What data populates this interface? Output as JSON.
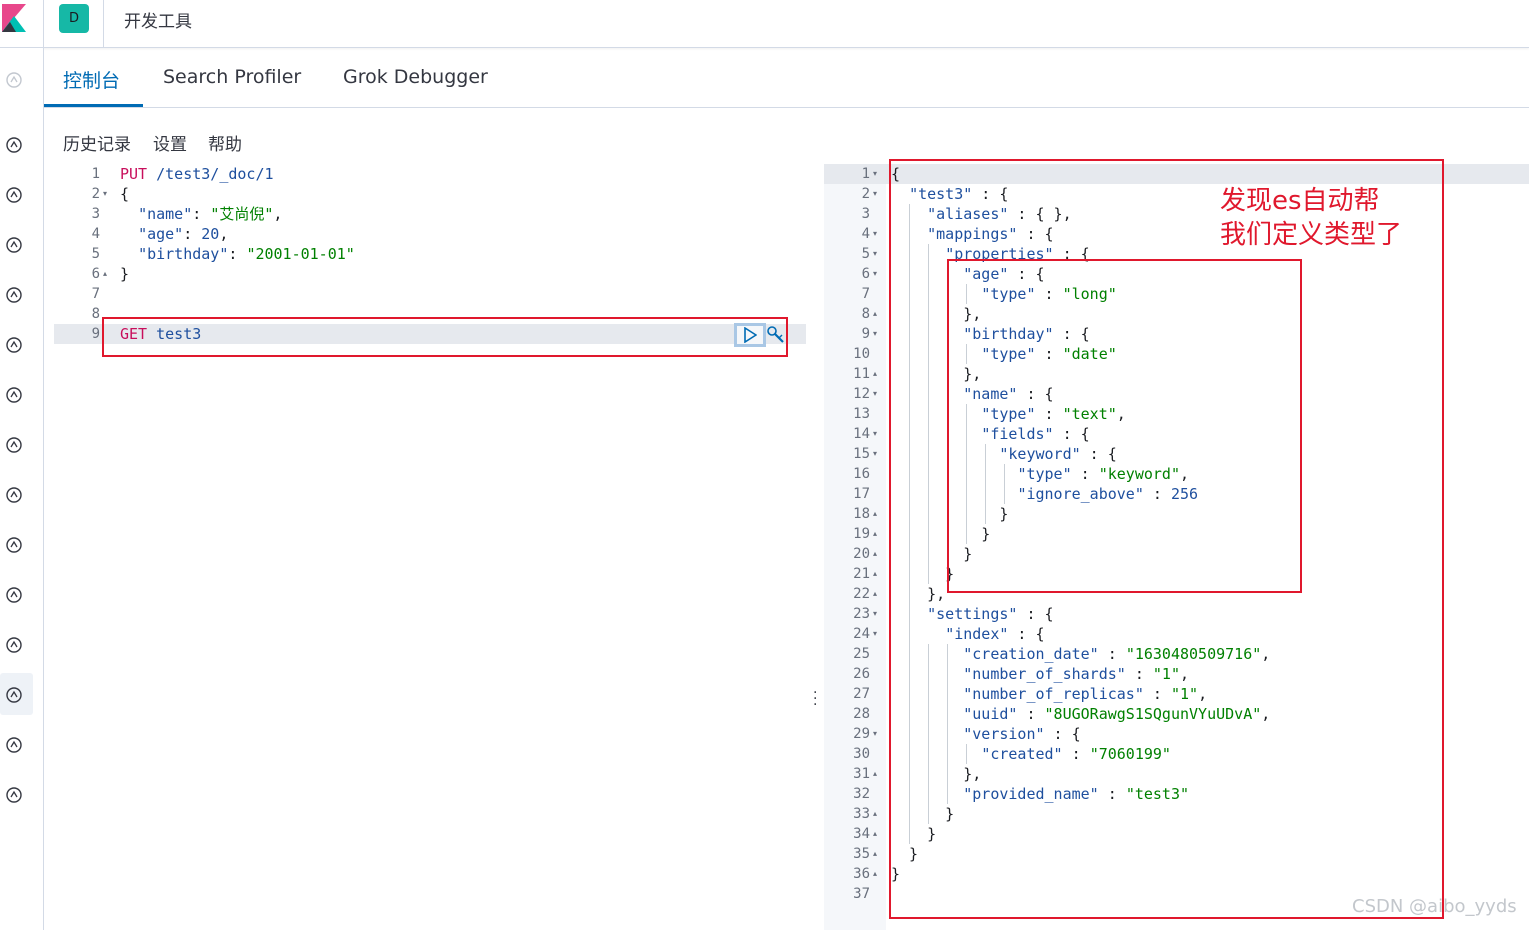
{
  "header": {
    "space_letter": "D",
    "app_title": "开发工具"
  },
  "tabs": [
    {
      "label": "控制台"
    },
    {
      "label": "Search Profiler"
    },
    {
      "label": "Grok Debugger"
    }
  ],
  "toolbar": {
    "history": "历史记录",
    "settings": "设置",
    "help": "帮助"
  },
  "sidenav": {
    "icons": [
      "recently-viewed-icon",
      "discover-icon",
      "visualize-icon",
      "dashboard-icon",
      "canvas-icon",
      "maps-icon",
      "ml-icon",
      "graph-icon",
      "siem-icon",
      "uptime-icon",
      "apm-icon",
      "infrastructure-icon",
      "dev-tools-icon",
      "monitoring-icon",
      "management-icon"
    ]
  },
  "request_editor": {
    "lines": [
      {
        "n": "1",
        "fold": "",
        "segs": [
          [
            "m",
            "PUT"
          ],
          [
            "p",
            " "
          ],
          [
            "u",
            "/test3/_doc/1"
          ]
        ]
      },
      {
        "n": "2",
        "fold": "▾",
        "segs": [
          [
            "p",
            "{"
          ]
        ]
      },
      {
        "n": "3",
        "fold": "",
        "segs": [
          [
            "p",
            "  "
          ],
          [
            "k",
            "\"name\""
          ],
          [
            "p",
            ": "
          ],
          [
            "s",
            "\"艾尚倪\""
          ],
          [
            "p",
            ","
          ]
        ]
      },
      {
        "n": "4",
        "fold": "",
        "segs": [
          [
            "p",
            "  "
          ],
          [
            "k",
            "\"age\""
          ],
          [
            "p",
            ": "
          ],
          [
            "n",
            "20"
          ],
          [
            "p",
            ","
          ]
        ]
      },
      {
        "n": "5",
        "fold": "",
        "segs": [
          [
            "p",
            "  "
          ],
          [
            "k",
            "\"birthday\""
          ],
          [
            "p",
            ": "
          ],
          [
            "s",
            "\"2001-01-01\""
          ]
        ]
      },
      {
        "n": "6",
        "fold": "▴",
        "segs": [
          [
            "p",
            "}"
          ]
        ]
      },
      {
        "n": "7",
        "fold": "",
        "segs": []
      },
      {
        "n": "8",
        "fold": "",
        "segs": []
      },
      {
        "n": "9",
        "fold": "",
        "segs": [
          [
            "m",
            "GET"
          ],
          [
            "p",
            " "
          ],
          [
            "u",
            "test3"
          ]
        ]
      }
    ]
  },
  "response_viewer": {
    "lines": [
      {
        "n": "1",
        "fold": "▾",
        "segs": [
          [
            "p",
            "{"
          ]
        ]
      },
      {
        "n": "2",
        "fold": "▾",
        "segs": [
          [
            "p",
            "  "
          ],
          [
            "k",
            "\"test3\""
          ],
          [
            "p",
            " : {"
          ]
        ]
      },
      {
        "n": "3",
        "fold": "",
        "segs": [
          [
            "p",
            "    "
          ],
          [
            "k",
            "\"aliases\""
          ],
          [
            "p",
            " : { },"
          ]
        ]
      },
      {
        "n": "4",
        "fold": "▾",
        "segs": [
          [
            "p",
            "    "
          ],
          [
            "k",
            "\"mappings\""
          ],
          [
            "p",
            " : {"
          ]
        ]
      },
      {
        "n": "5",
        "fold": "▾",
        "segs": [
          [
            "p",
            "      "
          ],
          [
            "k",
            "\"properties\""
          ],
          [
            "p",
            " : {"
          ]
        ]
      },
      {
        "n": "6",
        "fold": "▾",
        "segs": [
          [
            "p",
            "        "
          ],
          [
            "k",
            "\"age\""
          ],
          [
            "p",
            " : {"
          ]
        ]
      },
      {
        "n": "7",
        "fold": "",
        "segs": [
          [
            "p",
            "          "
          ],
          [
            "k",
            "\"type\""
          ],
          [
            "p",
            " : "
          ],
          [
            "s",
            "\"long\""
          ]
        ]
      },
      {
        "n": "8",
        "fold": "▴",
        "segs": [
          [
            "p",
            "        },"
          ]
        ]
      },
      {
        "n": "9",
        "fold": "▾",
        "segs": [
          [
            "p",
            "        "
          ],
          [
            "k",
            "\"birthday\""
          ],
          [
            "p",
            " : {"
          ]
        ]
      },
      {
        "n": "10",
        "fold": "",
        "segs": [
          [
            "p",
            "          "
          ],
          [
            "k",
            "\"type\""
          ],
          [
            "p",
            " : "
          ],
          [
            "s",
            "\"date\""
          ]
        ]
      },
      {
        "n": "11",
        "fold": "▴",
        "segs": [
          [
            "p",
            "        },"
          ]
        ]
      },
      {
        "n": "12",
        "fold": "▾",
        "segs": [
          [
            "p",
            "        "
          ],
          [
            "k",
            "\"name\""
          ],
          [
            "p",
            " : {"
          ]
        ]
      },
      {
        "n": "13",
        "fold": "",
        "segs": [
          [
            "p",
            "          "
          ],
          [
            "k",
            "\"type\""
          ],
          [
            "p",
            " : "
          ],
          [
            "s",
            "\"text\""
          ],
          [
            "p",
            ","
          ]
        ]
      },
      {
        "n": "14",
        "fold": "▾",
        "segs": [
          [
            "p",
            "          "
          ],
          [
            "k",
            "\"fields\""
          ],
          [
            "p",
            " : {"
          ]
        ]
      },
      {
        "n": "15",
        "fold": "▾",
        "segs": [
          [
            "p",
            "            "
          ],
          [
            "k",
            "\"keyword\""
          ],
          [
            "p",
            " : {"
          ]
        ]
      },
      {
        "n": "16",
        "fold": "",
        "segs": [
          [
            "p",
            "              "
          ],
          [
            "k",
            "\"type\""
          ],
          [
            "p",
            " : "
          ],
          [
            "s",
            "\"keyword\""
          ],
          [
            "p",
            ","
          ]
        ]
      },
      {
        "n": "17",
        "fold": "",
        "segs": [
          [
            "p",
            "              "
          ],
          [
            "k",
            "\"ignore_above\""
          ],
          [
            "p",
            " : "
          ],
          [
            "n",
            "256"
          ]
        ]
      },
      {
        "n": "18",
        "fold": "▴",
        "segs": [
          [
            "p",
            "            }"
          ]
        ]
      },
      {
        "n": "19",
        "fold": "▴",
        "segs": [
          [
            "p",
            "          }"
          ]
        ]
      },
      {
        "n": "20",
        "fold": "▴",
        "segs": [
          [
            "p",
            "        }"
          ]
        ]
      },
      {
        "n": "21",
        "fold": "▴",
        "segs": [
          [
            "p",
            "      }"
          ]
        ]
      },
      {
        "n": "22",
        "fold": "▴",
        "segs": [
          [
            "p",
            "    },"
          ]
        ]
      },
      {
        "n": "23",
        "fold": "▾",
        "segs": [
          [
            "p",
            "    "
          ],
          [
            "k",
            "\"settings\""
          ],
          [
            "p",
            " : {"
          ]
        ]
      },
      {
        "n": "24",
        "fold": "▾",
        "segs": [
          [
            "p",
            "      "
          ],
          [
            "k",
            "\"index\""
          ],
          [
            "p",
            " : {"
          ]
        ]
      },
      {
        "n": "25",
        "fold": "",
        "segs": [
          [
            "p",
            "        "
          ],
          [
            "k",
            "\"creation_date\""
          ],
          [
            "p",
            " : "
          ],
          [
            "s",
            "\"1630480509716\""
          ],
          [
            "p",
            ","
          ]
        ]
      },
      {
        "n": "26",
        "fold": "",
        "segs": [
          [
            "p",
            "        "
          ],
          [
            "k",
            "\"number_of_shards\""
          ],
          [
            "p",
            " : "
          ],
          [
            "s",
            "\"1\""
          ],
          [
            "p",
            ","
          ]
        ]
      },
      {
        "n": "27",
        "fold": "",
        "segs": [
          [
            "p",
            "        "
          ],
          [
            "k",
            "\"number_of_replicas\""
          ],
          [
            "p",
            " : "
          ],
          [
            "s",
            "\"1\""
          ],
          [
            "p",
            ","
          ]
        ]
      },
      {
        "n": "28",
        "fold": "",
        "segs": [
          [
            "p",
            "        "
          ],
          [
            "k",
            "\"uuid\""
          ],
          [
            "p",
            " : "
          ],
          [
            "s",
            "\"8UGORawgS1SQgunVYuUDvA\""
          ],
          [
            "p",
            ","
          ]
        ]
      },
      {
        "n": "29",
        "fold": "▾",
        "segs": [
          [
            "p",
            "        "
          ],
          [
            "k",
            "\"version\""
          ],
          [
            "p",
            " : {"
          ]
        ]
      },
      {
        "n": "30",
        "fold": "",
        "segs": [
          [
            "p",
            "          "
          ],
          [
            "k",
            "\"created\""
          ],
          [
            "p",
            " : "
          ],
          [
            "s",
            "\"7060199\""
          ]
        ]
      },
      {
        "n": "31",
        "fold": "▴",
        "segs": [
          [
            "p",
            "        },"
          ]
        ]
      },
      {
        "n": "32",
        "fold": "",
        "segs": [
          [
            "p",
            "        "
          ],
          [
            "k",
            "\"provided_name\""
          ],
          [
            "p",
            " : "
          ],
          [
            "s",
            "\"test3\""
          ]
        ]
      },
      {
        "n": "33",
        "fold": "▴",
        "segs": [
          [
            "p",
            "      }"
          ]
        ]
      },
      {
        "n": "34",
        "fold": "▴",
        "segs": [
          [
            "p",
            "    }"
          ]
        ]
      },
      {
        "n": "35",
        "fold": "▴",
        "segs": [
          [
            "p",
            "  }"
          ]
        ]
      },
      {
        "n": "36",
        "fold": "▴",
        "segs": [
          [
            "p",
            "}"
          ]
        ]
      },
      {
        "n": "37",
        "fold": "",
        "segs": []
      }
    ]
  },
  "annotation": "发现es自动帮\n我们定义类型了",
  "watermark": "CSDN @aibo_yyds",
  "colors": {
    "accent": "#006bb4",
    "annotation_red": "#e0182d",
    "badge": "#16b8a6"
  }
}
